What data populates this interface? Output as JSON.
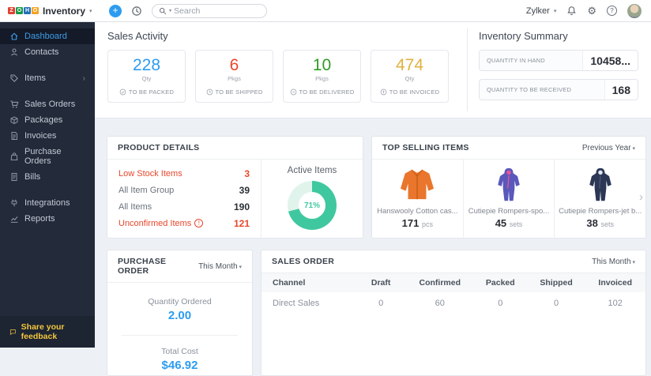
{
  "colors": {
    "accent": "#2d9cf0",
    "alert": "#e8472b",
    "green": "#2f9b27",
    "amber": "#e0b23e",
    "teal": "#3fc89f"
  },
  "topbar": {
    "brand_tiles": [
      {
        "ch": "Z",
        "color": "#e0412f"
      },
      {
        "ch": "O",
        "color": "#159a4a"
      },
      {
        "ch": "H",
        "color": "#2270b8"
      },
      {
        "ch": "O",
        "color": "#f4a223"
      }
    ],
    "product": "Inventory",
    "search_placeholder": "Search",
    "org": "Zylker"
  },
  "sidebar": {
    "items": [
      {
        "label": "Dashboard",
        "icon": "home-icon"
      },
      {
        "label": "Contacts",
        "icon": "person-icon"
      },
      {
        "label": "Items",
        "icon": "tag-icon"
      },
      {
        "label": "Sales Orders",
        "icon": "cart-icon"
      },
      {
        "label": "Packages",
        "icon": "box-icon"
      },
      {
        "label": "Invoices",
        "icon": "file-icon"
      },
      {
        "label": "Purchase Orders",
        "icon": "bag-icon"
      },
      {
        "label": "Bills",
        "icon": "receipt-icon"
      },
      {
        "label": "Integrations",
        "icon": "plug-icon"
      },
      {
        "label": "Reports",
        "icon": "chart-icon"
      }
    ],
    "feedback": "Share your feedback"
  },
  "sales_activity": {
    "title": "Sales Activity",
    "cards": [
      {
        "value": "228",
        "unit": "Qty",
        "label": "TO BE PACKED",
        "color": "#2d9cf0"
      },
      {
        "value": "6",
        "unit": "Pkgs",
        "label": "TO BE SHIPPED",
        "color": "#e8472b"
      },
      {
        "value": "10",
        "unit": "Pkgs",
        "label": "TO BE DELIVERED",
        "color": "#2f9b27"
      },
      {
        "value": "474",
        "unit": "Qty",
        "label": "TO BE INVOICED",
        "color": "#e0b23e"
      }
    ]
  },
  "inventory_summary": {
    "title": "Inventory Summary",
    "rows": [
      {
        "label": "QUANTITY IN HAND",
        "value": "10458..."
      },
      {
        "label": "QUANTITY TO BE RECEIVED",
        "value": "168"
      }
    ]
  },
  "product_details": {
    "title": "PRODUCT DETAILS",
    "rows": [
      {
        "label": "Low Stock Items",
        "value": "3",
        "alert": true
      },
      {
        "label": "All Item Group",
        "value": "39"
      },
      {
        "label": "All Items",
        "value": "190"
      },
      {
        "label": "Unconfirmed Items",
        "value": "121",
        "alert": true,
        "info": true
      }
    ],
    "donut": {
      "label": "Active Items",
      "percent": 71,
      "text": "71%",
      "color": "#3fc89f",
      "track": "#e0f4ec"
    }
  },
  "top_selling": {
    "title": "TOP SELLING ITEMS",
    "range": "Previous Year",
    "items": [
      {
        "name": "Hanswooly Cotton cas...",
        "qty": "171",
        "unit": "pcs",
        "image": "orange-cardigan"
      },
      {
        "name": "Cutiepie Rompers-spo...",
        "qty": "45",
        "unit": "sets",
        "image": "purple-romper"
      },
      {
        "name": "Cutiepie Rompers-jet b...",
        "qty": "38",
        "unit": "sets",
        "image": "navy-romper"
      }
    ]
  },
  "purchase_order": {
    "title": "PURCHASE ORDER",
    "range": "This Month",
    "qty_label": "Quantity Ordered",
    "qty_value": "2.00",
    "cost_label": "Total Cost",
    "cost_value": "$46.92"
  },
  "sales_order": {
    "title": "SALES ORDER",
    "range": "This Month",
    "columns": [
      "Channel",
      "Draft",
      "Confirmed",
      "Packed",
      "Shipped",
      "Invoiced"
    ],
    "rows": [
      [
        "Direct Sales",
        "0",
        "60",
        "0",
        "0",
        "102"
      ]
    ]
  }
}
